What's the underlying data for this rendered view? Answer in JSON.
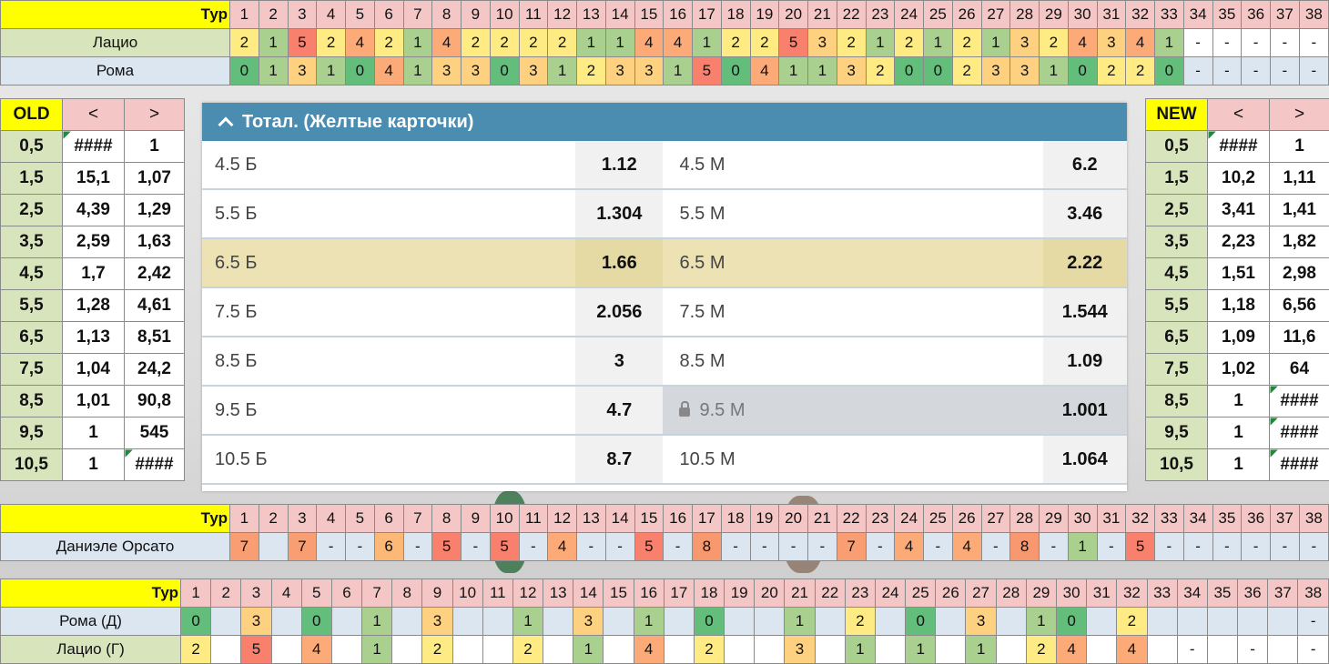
{
  "colors": {
    "c1": "#a9d08e",
    "c0": "#63be7b",
    "c2": "#ffeb84",
    "c3": "#fdd17f",
    "c4": "#fcaa78",
    "c5": "#f8806d",
    "c6": "#fbb877",
    "c7": "#f99e73",
    "c8": "#f8986f"
  },
  "top_table": {
    "header": "Тур",
    "rounds": [
      "1",
      "2",
      "3",
      "4",
      "5",
      "6",
      "7",
      "8",
      "9",
      "10",
      "11",
      "12",
      "13",
      "14",
      "15",
      "16",
      "17",
      "18",
      "19",
      "20",
      "21",
      "22",
      "23",
      "24",
      "25",
      "26",
      "27",
      "28",
      "29",
      "30",
      "31",
      "32",
      "33",
      "34",
      "35",
      "36",
      "37",
      "38"
    ],
    "rows": [
      {
        "label": "Лацио",
        "values": [
          "2",
          "1",
          "5",
          "2",
          "4",
          "2",
          "1",
          "4",
          "2",
          "2",
          "2",
          "2",
          "1",
          "1",
          "4",
          "4",
          "1",
          "2",
          "2",
          "5",
          "3",
          "2",
          "1",
          "2",
          "1",
          "2",
          "1",
          "3",
          "2",
          "4",
          "3",
          "4",
          "1",
          "-",
          "-",
          "-",
          "-",
          "-"
        ]
      },
      {
        "label": "Рома",
        "values": [
          "0",
          "1",
          "3",
          "1",
          "0",
          "4",
          "1",
          "3",
          "3",
          "0",
          "3",
          "1",
          "2",
          "3",
          "3",
          "1",
          "5",
          "0",
          "4",
          "1",
          "1",
          "3",
          "2",
          "0",
          "0",
          "2",
          "3",
          "3",
          "1",
          "0",
          "2",
          "2",
          "0",
          "-",
          "-",
          "-",
          "-",
          "-"
        ]
      }
    ]
  },
  "old_table": {
    "title": "OLD",
    "lt": "<",
    "gt": ">",
    "rows": [
      [
        "0,5",
        "####",
        "1"
      ],
      [
        "1,5",
        "15,1",
        "1,07"
      ],
      [
        "2,5",
        "4,39",
        "1,29"
      ],
      [
        "3,5",
        "2,59",
        "1,63"
      ],
      [
        "4,5",
        "1,7",
        "2,42"
      ],
      [
        "5,5",
        "1,28",
        "4,61"
      ],
      [
        "6,5",
        "1,13",
        "8,51"
      ],
      [
        "7,5",
        "1,04",
        "24,2"
      ],
      [
        "8,5",
        "1,01",
        "90,8"
      ],
      [
        "9,5",
        "1",
        "545"
      ],
      [
        "10,5",
        "1",
        "####"
      ]
    ]
  },
  "new_table": {
    "title": "NEW",
    "lt": "<",
    "gt": ">",
    "rows": [
      [
        "0,5",
        "####",
        "1"
      ],
      [
        "1,5",
        "10,2",
        "1,11"
      ],
      [
        "2,5",
        "3,41",
        "1,41"
      ],
      [
        "3,5",
        "2,23",
        "1,82"
      ],
      [
        "4,5",
        "1,51",
        "2,98"
      ],
      [
        "5,5",
        "1,18",
        "6,56"
      ],
      [
        "6,5",
        "1,09",
        "11,6"
      ],
      [
        "7,5",
        "1,02",
        "64"
      ],
      [
        "8,5",
        "1",
        "####"
      ],
      [
        "9,5",
        "1",
        "####"
      ],
      [
        "10,5",
        "1",
        "####"
      ]
    ]
  },
  "panel": {
    "title": "Тотал. (Желтые карточки)",
    "rows": [
      {
        "over": "4.5 Б",
        "over_odds": "1.12",
        "under": "4.5 М",
        "under_odds": "6.2"
      },
      {
        "over": "5.5 Б",
        "over_odds": "1.304",
        "under": "5.5 М",
        "under_odds": "3.46"
      },
      {
        "over": "6.5 Б",
        "over_odds": "1.66",
        "under": "6.5 М",
        "under_odds": "2.22"
      },
      {
        "over": "7.5 Б",
        "over_odds": "2.056",
        "under": "7.5 М",
        "under_odds": "1.544"
      },
      {
        "over": "8.5 Б",
        "over_odds": "3",
        "under": "8.5 М",
        "under_odds": "1.09"
      },
      {
        "over": "9.5 Б",
        "over_odds": "4.7",
        "under": "9.5 М",
        "under_odds": "1.001"
      },
      {
        "over": "10.5 Б",
        "over_odds": "8.7",
        "under": "10.5 М",
        "under_odds": "1.064"
      }
    ]
  },
  "referee_table": {
    "header": "Тур",
    "label": "Даниэле Орсато",
    "values": [
      "7",
      "",
      "7",
      "-",
      "-",
      "6",
      "-",
      "5",
      "-",
      "5",
      "-",
      "4",
      "-",
      "-",
      "5",
      "-",
      "8",
      "-",
      "-",
      "-",
      "-",
      "7",
      "-",
      "4",
      "-",
      "4",
      "-",
      "8",
      "-",
      "1",
      "-",
      "5",
      "-",
      "-",
      "-",
      "-",
      "-",
      "-"
    ]
  },
  "bottom_table": {
    "header": "Тур",
    "rows": [
      {
        "label": "Рома (Д)",
        "values": [
          "0",
          "",
          "3",
          "",
          "0",
          "",
          "1",
          "",
          "3",
          "",
          "",
          "1",
          "",
          "3",
          "",
          "1",
          "",
          "0",
          "",
          "",
          "1",
          "",
          "2",
          "",
          "0",
          "",
          "3",
          "",
          "1",
          "0",
          "",
          "2",
          "",
          "",
          "",
          "",
          "",
          "-"
        ]
      },
      {
        "label": "Лацио (Г)",
        "values": [
          "2",
          "",
          "5",
          "",
          "4",
          "",
          "1",
          "",
          "2",
          "",
          "",
          "2",
          "",
          "1",
          "",
          "4",
          "",
          "2",
          "",
          "",
          "3",
          "",
          "1",
          "",
          "1",
          "",
          "1",
          "",
          "2",
          "4",
          "",
          "4",
          "",
          "-",
          "",
          "-",
          "",
          "-"
        ]
      }
    ]
  }
}
